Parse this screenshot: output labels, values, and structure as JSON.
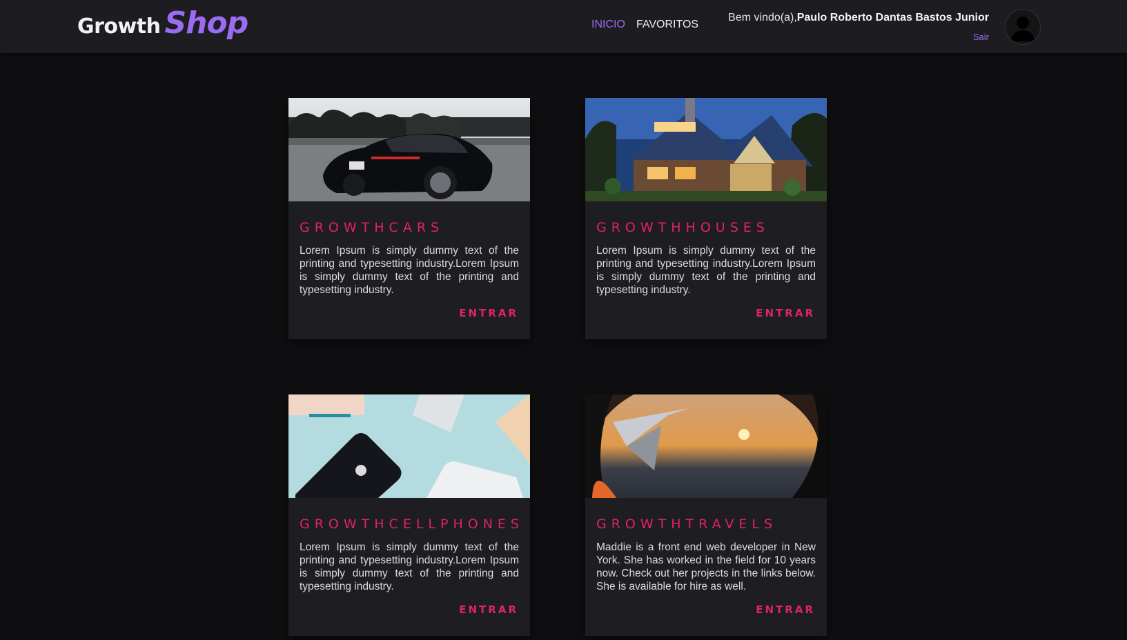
{
  "brand": {
    "part1": "Growth",
    "part2": "Shop"
  },
  "nav": {
    "inicio": "INICIO",
    "favoritos": "FAVORITOS"
  },
  "user": {
    "greeting": "Bem vindo(a),",
    "name": "Paulo Roberto Dantas Bastos Junior",
    "logout": "Sair"
  },
  "colors": {
    "accent": "#9b6cf2",
    "title": "#e0245e",
    "background": "#0f0f11",
    "card": "#1e1d22"
  },
  "cards": [
    {
      "title": "GROWTHCARS",
      "text": "Lorem Ipsum is simply dummy text of the printing and typesetting industry.Lorem Ipsum is simply dummy text of the printing and typesetting industry.",
      "button": "ENTRAR"
    },
    {
      "title": "GROWTHHOUSES",
      "text": "Lorem Ipsum is simply dummy text of the printing and typesetting industry.Lorem Ipsum is simply dummy text of the printing and typesetting industry.",
      "button": "ENTRAR"
    },
    {
      "title": "GROWTHCELLPHONES",
      "text": "Lorem Ipsum is simply dummy text of the printing and typesetting industry.Lorem Ipsum is simply dummy text of the printing and typesetting industry.",
      "button": "ENTRAR"
    },
    {
      "title": "GROWTHTRAVELS",
      "text": "Maddie is a front end web developer in New York. She has worked in the field for 10 years now. Check out her projects in the links below. She is available for hire as well.",
      "button": "ENTRAR"
    }
  ]
}
